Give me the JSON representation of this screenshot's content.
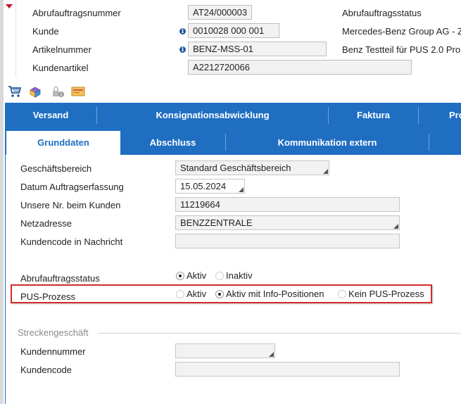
{
  "header": {
    "rows": [
      {
        "label": "Abrufauftragsnummer",
        "value": "AT24/000003",
        "right_label": "Abrufauftragsstatus"
      },
      {
        "label": "Kunde",
        "value": "0010028 000 001",
        "right_label": "Mercedes-Benz Group AG - Z"
      },
      {
        "label": "Artikelnummer",
        "value": "BENZ-MSS-01",
        "right_label": "Benz Testteil für PUS 2.0 Pro"
      },
      {
        "label": "Kundenartikel",
        "value": "A2212720066"
      }
    ]
  },
  "toolbar": {
    "icons": [
      "shopping-cart-icon",
      "package-icon",
      "lock-info-icon",
      "mail-icon"
    ]
  },
  "tabs_row1": [
    "Versand",
    "Konsignationsabwicklung",
    "Faktura",
    "Pro"
  ],
  "tabs_row2": [
    "Grunddaten",
    "Abschluss",
    "Kommunikation extern"
  ],
  "form": {
    "geschaeftsbereich": {
      "label": "Geschäftsbereich",
      "value": "Standard Geschäftsbereich"
    },
    "datum": {
      "label": "Datum Auftragserfassung",
      "value": "15.05.2024"
    },
    "unsere_nr": {
      "label": "Unsere Nr. beim Kunden",
      "value": "11219664"
    },
    "netzadresse": {
      "label": "Netzadresse",
      "value": "BENZZENTRALE"
    },
    "kundencode_nachricht": {
      "label": "Kundencode in Nachricht",
      "value": ""
    },
    "abrufauftragsstatus": {
      "label": "Abrufauftragsstatus",
      "options": [
        "Aktiv",
        "Inaktiv"
      ],
      "selected": "Aktiv"
    },
    "pus_prozess": {
      "label": "PUS-Prozess",
      "options": [
        "Aktiv",
        "Aktiv mit Info-Positionen",
        "Kein PUS-Prozess"
      ],
      "selected": "Aktiv mit Info-Positionen"
    }
  },
  "streckengeschaeft": {
    "title": "Streckengeschäft",
    "kundennummer": {
      "label": "Kundennummer",
      "value": ""
    },
    "kundencode": {
      "label": "Kundencode",
      "value": ""
    }
  },
  "colors": {
    "tab_blue": "#1f6ec2",
    "highlight_red": "#d52b2b"
  }
}
